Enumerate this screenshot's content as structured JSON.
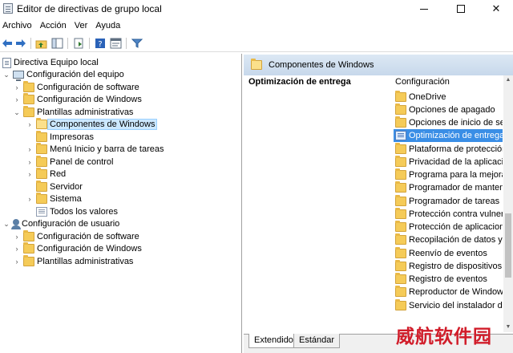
{
  "window": {
    "title": "Editor de directivas de grupo local",
    "controls": [
      "minimize",
      "maximize",
      "close"
    ]
  },
  "menu": [
    "Archivo",
    "Acción",
    "Ver",
    "Ayuda"
  ],
  "toolbar": [
    "back-icon",
    "forward-icon",
    "up-folder-icon",
    "show-hide-tree-icon",
    "export-icon",
    "help-icon",
    "properties-icon",
    "filter-icon"
  ],
  "tree": [
    {
      "label": "Directiva Equipo local",
      "icon": "document-icon",
      "expanded": true
    },
    {
      "label": "Configuración del equipo",
      "icon": "computer-icon",
      "expanded": true
    },
    {
      "label": "Configuración de software",
      "icon": "folder-icon",
      "expanded": false
    },
    {
      "label": "Configuración de Windows",
      "icon": "folder-icon",
      "expanded": false
    },
    {
      "label": "Plantillas administrativas",
      "icon": "folder-icon",
      "expanded": true
    },
    {
      "label": "Componentes de Windows",
      "icon": "folder-icon",
      "expanded": false,
      "selected": true
    },
    {
      "label": "Impresoras",
      "icon": "folder-icon"
    },
    {
      "label": "Menú Inicio y barra de tareas",
      "icon": "folder-icon",
      "expanded": false
    },
    {
      "label": "Panel de control",
      "icon": "folder-icon",
      "expanded": false
    },
    {
      "label": "Red",
      "icon": "folder-icon",
      "expanded": false
    },
    {
      "label": "Servidor",
      "icon": "folder-icon"
    },
    {
      "label": "Sistema",
      "icon": "folder-icon",
      "expanded": false
    },
    {
      "label": "Todos los valores",
      "icon": "all-values-icon"
    },
    {
      "label": "Configuración de usuario",
      "icon": "users-icon",
      "expanded": true
    },
    {
      "label": "Configuración de software",
      "icon": "folder-icon",
      "expanded": false
    },
    {
      "label": "Configuración de Windows",
      "icon": "folder-icon",
      "expanded": false
    },
    {
      "label": "Plantillas administrativas",
      "icon": "folder-icon",
      "expanded": false
    }
  ],
  "details": {
    "header_title": "Componentes de Windows",
    "description_title": "Optimización de entrega",
    "column_header": "Configuración",
    "items": [
      {
        "label": "OneDrive",
        "icon": "folder-icon"
      },
      {
        "label": "Opciones de apagado",
        "icon": "folder-icon"
      },
      {
        "label": "Opciones de inicio de sesi",
        "icon": "folder-icon"
      },
      {
        "label": "Optimización de entrega",
        "icon": "folder-icon",
        "selected": true
      },
      {
        "label": "Plataforma de protección",
        "icon": "folder-icon"
      },
      {
        "label": "Privacidad de la aplicación",
        "icon": "folder-icon"
      },
      {
        "label": "Programa para la mejora c",
        "icon": "folder-icon"
      },
      {
        "label": "Programador de mantenir",
        "icon": "folder-icon"
      },
      {
        "label": "Programador de tareas",
        "icon": "folder-icon"
      },
      {
        "label": "Protección contra vulnera",
        "icon": "folder-icon"
      },
      {
        "label": "Protección de aplicacione",
        "icon": "folder-icon"
      },
      {
        "label": "Recopilación de datos y v",
        "icon": "folder-icon"
      },
      {
        "label": "Reenvío de eventos",
        "icon": "folder-icon"
      },
      {
        "label": "Registro de dispositivos",
        "icon": "folder-icon"
      },
      {
        "label": "Registro de eventos",
        "icon": "folder-icon"
      },
      {
        "label": "Reproductor de Windows",
        "icon": "folder-icon"
      },
      {
        "label": "Servicio del instalador de A",
        "icon": "folder-icon"
      }
    ]
  },
  "tabs": [
    "Extendido",
    "Estándar"
  ],
  "watermark": "威航软件园",
  "colors": {
    "selection": "#3a8ee6",
    "header_band": "#c7d8eb",
    "folder": "#f5cb58",
    "watermark": "#d11d2a"
  }
}
